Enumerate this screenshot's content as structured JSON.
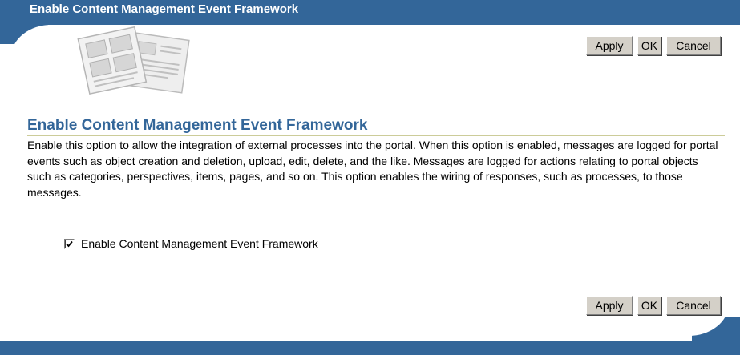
{
  "header": {
    "title": "Enable Content Management Event Framework",
    "bar_color": "#336699"
  },
  "decoration": {
    "icon": "documents-illustration-icon"
  },
  "buttons": {
    "apply": "Apply",
    "ok": "OK",
    "cancel": "Cancel"
  },
  "section": {
    "heading": "Enable Content Management Event Framework",
    "description": "Enable this option to allow the integration of external processes into the portal. When this option is enabled, messages are logged for portal events such as object creation and deletion, upload, edit, delete, and the like. Messages are logged for actions relating to portal objects such as categories, perspectives, items, pages, and so on. This option enables the wiring of responses, such as processes, to those messages."
  },
  "option": {
    "label": "Enable Content Management Event Framework",
    "checked": true
  }
}
